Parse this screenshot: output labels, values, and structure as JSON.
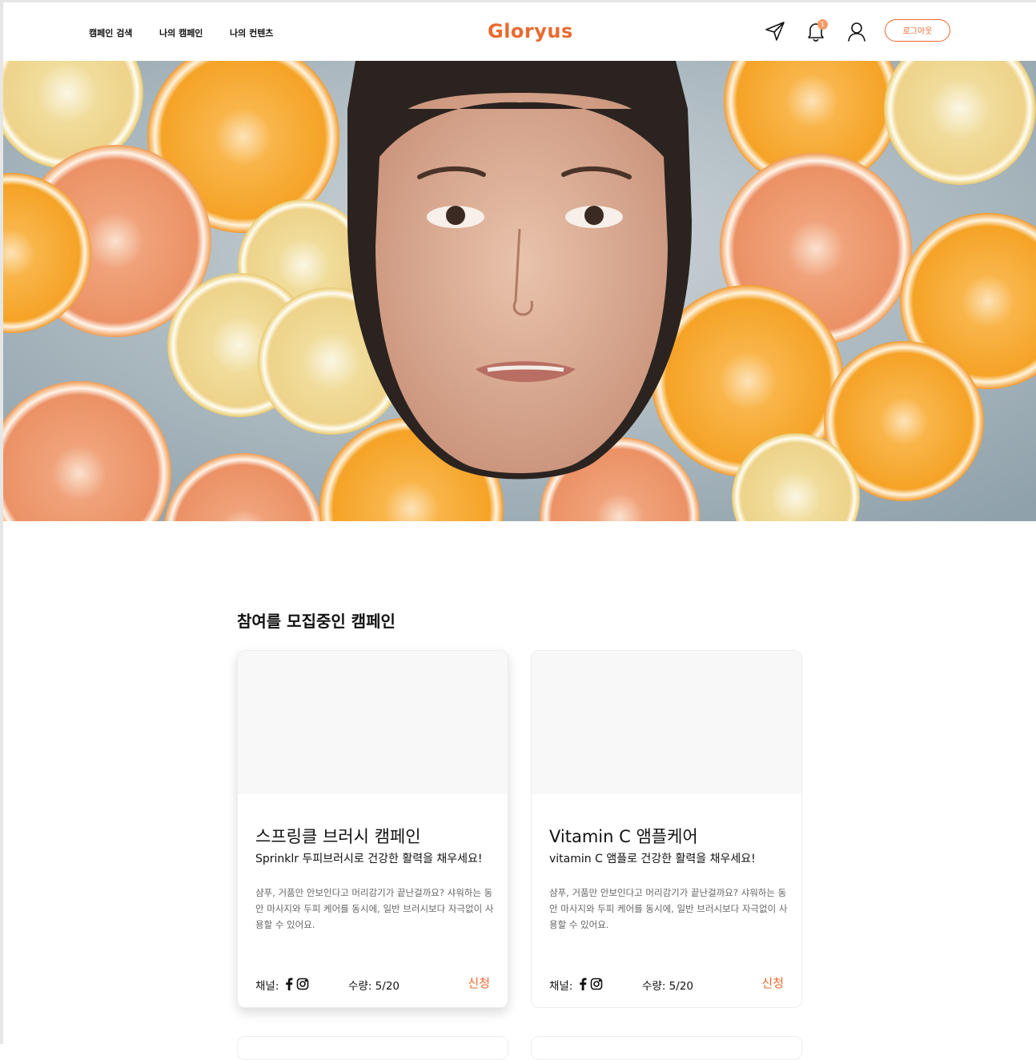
{
  "header": {
    "nav": [
      "캠페인 검색",
      "나의 캠페인",
      "나의 컨텐츠"
    ],
    "logo": "Gloryus",
    "notification_count": "1",
    "logout_label": "로그아웃"
  },
  "hero": {
    "image": "woman-face-in-water-with-citrus-slices"
  },
  "section": {
    "title": "참여를 모집중인 캠페인"
  },
  "campaigns": [
    {
      "title": "스프링클 브러시 캠페인",
      "subtitle": "Sprinklr 두피브러시로 건강한 활력을 채우세요!",
      "description": "샴푸, 거품만 안보인다고 머리감기가 끝난걸까요? 샤워하는 동안 마사지와 두피 케어를 동시에, 일반 브러시보다 자극없이 사용할 수 있어요.",
      "channel_label": "채널:",
      "channels": [
        "facebook-icon",
        "instagram-icon"
      ],
      "quantity": "수량: 5/20",
      "apply_label": "신청"
    },
    {
      "title": "Vitamin C 앰플케어",
      "subtitle": "vitamin C 앰플로 건강한 활력을 채우세요!",
      "description": "샴푸, 거품만 안보인다고 머리감기가 끝난걸까요? 샤워하는 동안 마사지와 두피 케어를 동시에, 일반 브러시보다 자극없이 사용할 수 있어요.",
      "channel_label": "채널:",
      "channels": [
        "facebook-icon",
        "instagram-icon"
      ],
      "quantity": "수량: 5/20",
      "apply_label": "신청"
    }
  ],
  "colors": {
    "accent": "#ea6a2f",
    "badge": "#f39a66",
    "text": "#111111",
    "muted_text": "#666666",
    "card_image_placeholder": "#f8f8f8"
  }
}
